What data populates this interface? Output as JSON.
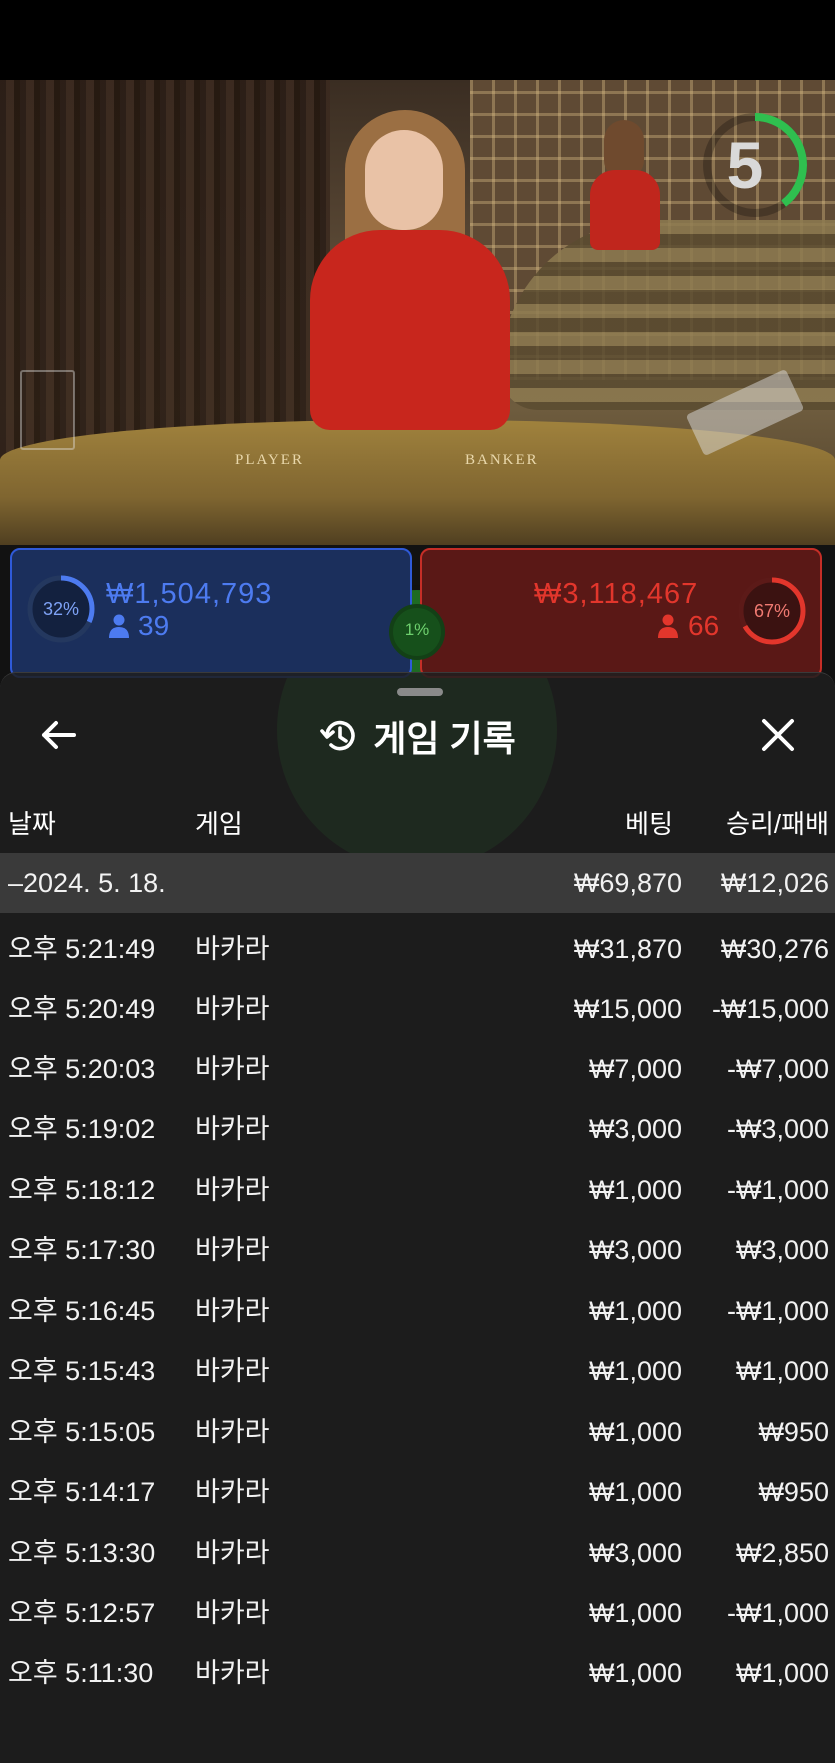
{
  "timer": {
    "value": "5",
    "ring_color": "#2fbf4f"
  },
  "table_labels": {
    "player": "PLAYER",
    "banker": "BANKER"
  },
  "player": {
    "percent": "32%",
    "amount": "₩1,504,793",
    "count": "39",
    "color": "#4d7bf0"
  },
  "banker": {
    "percent": "67%",
    "amount": "₩3,118,467",
    "count": "66",
    "color": "#e2362c"
  },
  "tie": {
    "percent": "1%"
  },
  "sheet": {
    "title": "게임 기록",
    "back_icon": "arrow-left-icon",
    "close_icon": "close-icon",
    "history_icon": "history-icon"
  },
  "columns": {
    "date": "날짜",
    "game": "게임",
    "bet": "베팅",
    "result": "승리/패배"
  },
  "date_group": {
    "date": "–2024. 5. 18.",
    "bet": "₩69,870",
    "result": "₩12,026"
  },
  "rows": [
    {
      "time": "오후 5:21:49",
      "game": "바카라",
      "bet": "₩31,870",
      "result": "₩30,276"
    },
    {
      "time": "오후 5:20:49",
      "game": "바카라",
      "bet": "₩15,000",
      "result": "-₩15,000"
    },
    {
      "time": "오후 5:20:03",
      "game": "바카라",
      "bet": "₩7,000",
      "result": "-₩7,000"
    },
    {
      "time": "오후 5:19:02",
      "game": "바카라",
      "bet": "₩3,000",
      "result": "-₩3,000"
    },
    {
      "time": "오후 5:18:12",
      "game": "바카라",
      "bet": "₩1,000",
      "result": "-₩1,000"
    },
    {
      "time": "오후 5:17:30",
      "game": "바카라",
      "bet": "₩3,000",
      "result": "₩3,000"
    },
    {
      "time": "오후 5:16:45",
      "game": "바카라",
      "bet": "₩1,000",
      "result": "-₩1,000"
    },
    {
      "time": "오후 5:15:43",
      "game": "바카라",
      "bet": "₩1,000",
      "result": "₩1,000"
    },
    {
      "time": "오후 5:15:05",
      "game": "바카라",
      "bet": "₩1,000",
      "result": "₩950"
    },
    {
      "time": "오후 5:14:17",
      "game": "바카라",
      "bet": "₩1,000",
      "result": "₩950"
    },
    {
      "time": "오후 5:13:30",
      "game": "바카라",
      "bet": "₩3,000",
      "result": "₩2,850"
    },
    {
      "time": "오후 5:12:57",
      "game": "바카라",
      "bet": "₩1,000",
      "result": "-₩1,000"
    },
    {
      "time": "오후 5:11:30",
      "game": "바카라",
      "bet": "₩1,000",
      "result": "₩1,000"
    }
  ]
}
